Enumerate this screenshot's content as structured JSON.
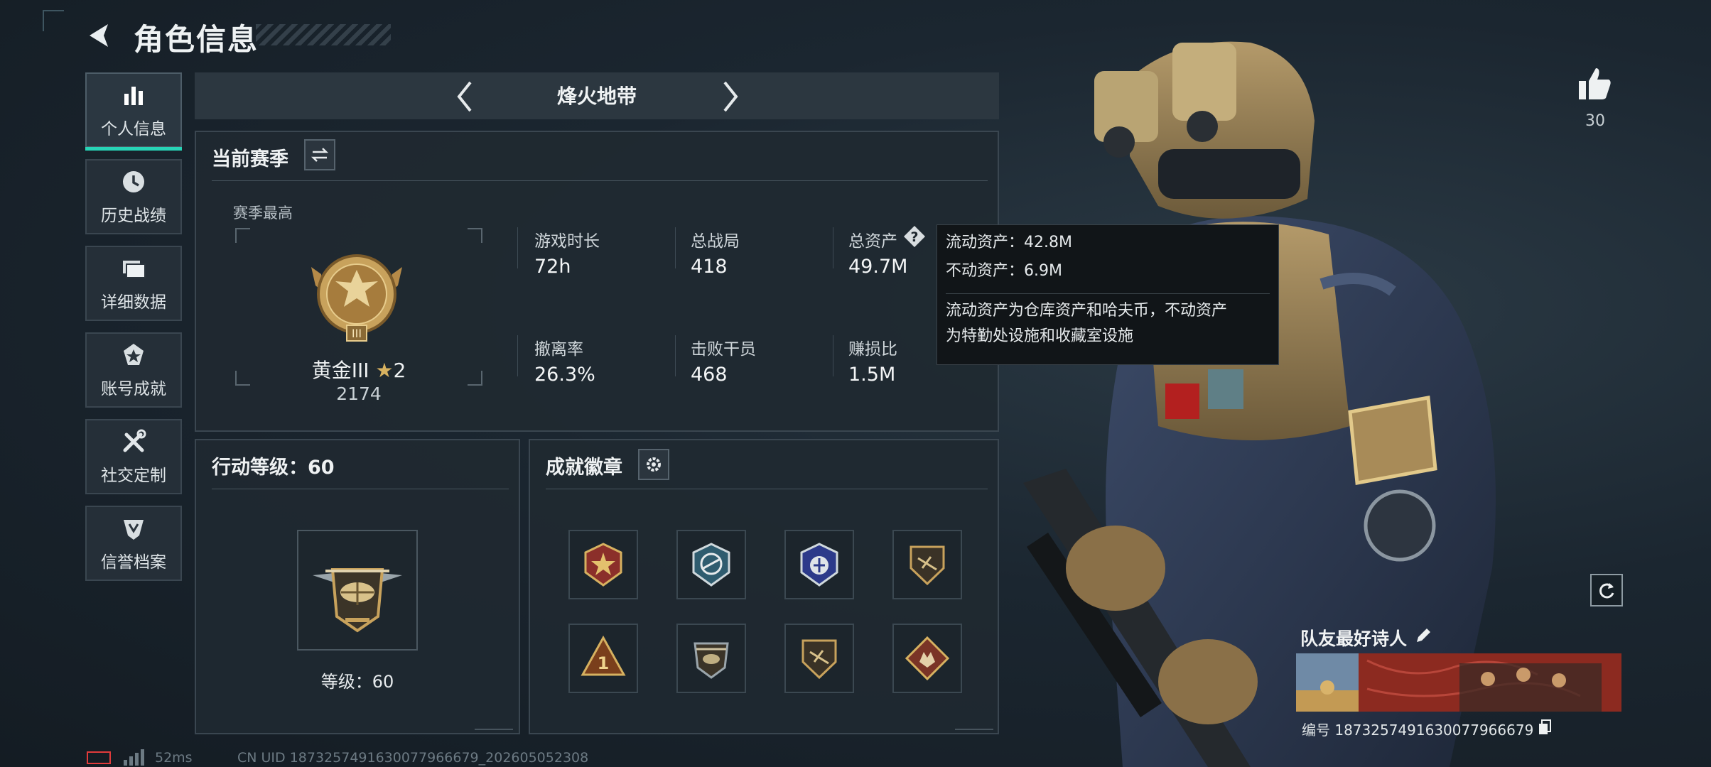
{
  "header": {
    "title": "角色信息"
  },
  "sidebar": {
    "items": [
      {
        "label": "个人信息",
        "icon": "stats-icon",
        "active": true
      },
      {
        "label": "历史战绩",
        "icon": "clock-icon"
      },
      {
        "label": "详细数据",
        "icon": "folder-icon"
      },
      {
        "label": "账号成就",
        "icon": "medal-icon"
      },
      {
        "label": "社交定制",
        "icon": "tools-icon"
      },
      {
        "label": "信誉档案",
        "icon": "shield-icon"
      }
    ]
  },
  "mode": {
    "label": "烽火地带"
  },
  "season": {
    "title": "当前赛季",
    "best_label": "赛季最高",
    "rank_name": "黄金III",
    "rank_stars": "2",
    "rank_score": "2174",
    "stats": [
      {
        "label": "游戏时长",
        "value": "72h"
      },
      {
        "label": "总战局",
        "value": "418"
      },
      {
        "label": "总资产",
        "value": "49.7M"
      },
      {
        "label": "撤离率",
        "value": "26.3%"
      },
      {
        "label": "击败干员",
        "value": "468"
      },
      {
        "label": "赚损比",
        "value": "1.5M"
      }
    ]
  },
  "tooltip": {
    "liquid": "流动资产：42.8M",
    "fixed": "不动资产：6.9M",
    "desc_line1": "流动资产为仓库资产和哈夫币，不动资产",
    "desc_line2": "为特勤处设施和收藏室设施"
  },
  "level": {
    "title": "行动等级：60",
    "label": "等级：60"
  },
  "badges": {
    "title": "成就徽章",
    "count": 8
  },
  "likes": {
    "count": "30"
  },
  "card": {
    "title": "队友最好诗人",
    "id": "编号 1873257491630077966679"
  },
  "footer": {
    "ping": "52ms",
    "uid": "CN UID 1873257491630077966679_202605052308"
  },
  "colors": {
    "accent": "#27d4b6",
    "battery": "#e23b3b",
    "gold": "#c8a25c"
  }
}
